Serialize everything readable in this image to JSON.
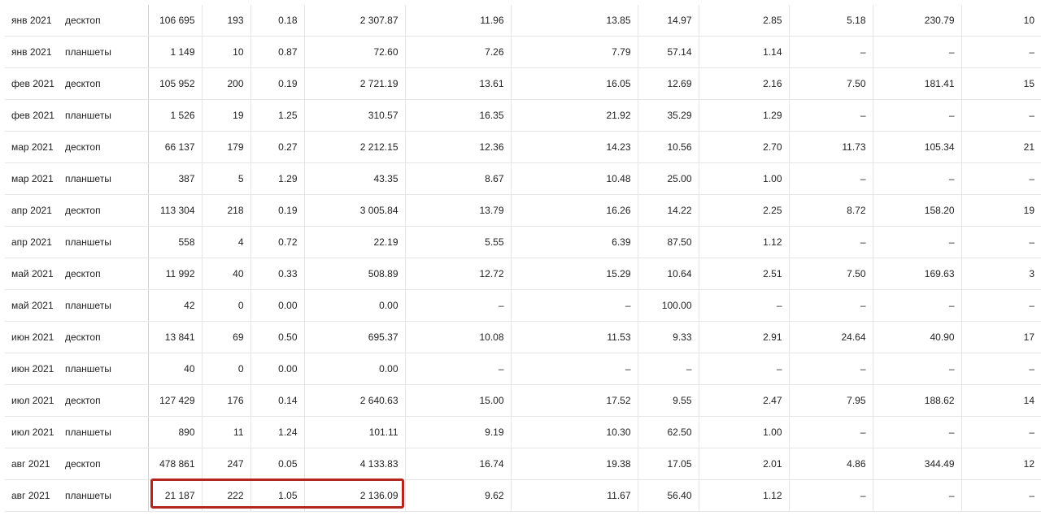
{
  "rows": [
    {
      "month": "янв 2021",
      "device": "десктоп",
      "values": [
        "106 695",
        "193",
        "0.18",
        "2 307.87",
        "11.96",
        "13.85",
        "14.97",
        "2.85",
        "5.18",
        "230.79",
        "10"
      ]
    },
    {
      "month": "янв 2021",
      "device": "планшеты",
      "values": [
        "1 149",
        "10",
        "0.87",
        "72.60",
        "7.26",
        "7.79",
        "57.14",
        "1.14",
        "–",
        "–",
        "–"
      ]
    },
    {
      "month": "фев 2021",
      "device": "десктоп",
      "values": [
        "105 952",
        "200",
        "0.19",
        "2 721.19",
        "13.61",
        "16.05",
        "12.69",
        "2.16",
        "7.50",
        "181.41",
        "15"
      ]
    },
    {
      "month": "фев 2021",
      "device": "планшеты",
      "values": [
        "1 526",
        "19",
        "1.25",
        "310.57",
        "16.35",
        "21.92",
        "35.29",
        "1.29",
        "–",
        "–",
        "–"
      ]
    },
    {
      "month": "мар 2021",
      "device": "десктоп",
      "values": [
        "66 137",
        "179",
        "0.27",
        "2 212.15",
        "12.36",
        "14.23",
        "10.56",
        "2.70",
        "11.73",
        "105.34",
        "21"
      ]
    },
    {
      "month": "мар 2021",
      "device": "планшеты",
      "values": [
        "387",
        "5",
        "1.29",
        "43.35",
        "8.67",
        "10.48",
        "25.00",
        "1.00",
        "–",
        "–",
        "–"
      ]
    },
    {
      "month": "апр 2021",
      "device": "десктоп",
      "values": [
        "113 304",
        "218",
        "0.19",
        "3 005.84",
        "13.79",
        "16.26",
        "14.22",
        "2.25",
        "8.72",
        "158.20",
        "19"
      ]
    },
    {
      "month": "апр 2021",
      "device": "планшеты",
      "values": [
        "558",
        "4",
        "0.72",
        "22.19",
        "5.55",
        "6.39",
        "87.50",
        "1.12",
        "–",
        "–",
        "–"
      ]
    },
    {
      "month": "май 2021",
      "device": "десктоп",
      "values": [
        "11 992",
        "40",
        "0.33",
        "508.89",
        "12.72",
        "15.29",
        "10.64",
        "2.51",
        "7.50",
        "169.63",
        "3"
      ]
    },
    {
      "month": "май 2021",
      "device": "планшеты",
      "values": [
        "42",
        "0",
        "0.00",
        "0.00",
        "–",
        "–",
        "100.00",
        "–",
        "–",
        "–",
        "–"
      ]
    },
    {
      "month": "июн 2021",
      "device": "десктоп",
      "values": [
        "13 841",
        "69",
        "0.50",
        "695.37",
        "10.08",
        "11.53",
        "9.33",
        "2.91",
        "24.64",
        "40.90",
        "17"
      ]
    },
    {
      "month": "июн 2021",
      "device": "планшеты",
      "values": [
        "40",
        "0",
        "0.00",
        "0.00",
        "–",
        "–",
        "–",
        "–",
        "–",
        "–",
        "–"
      ]
    },
    {
      "month": "июл 2021",
      "device": "десктоп",
      "values": [
        "127 429",
        "176",
        "0.14",
        "2 640.63",
        "15.00",
        "17.52",
        "9.55",
        "2.47",
        "7.95",
        "188.62",
        "14"
      ]
    },
    {
      "month": "июл 2021",
      "device": "планшеты",
      "values": [
        "890",
        "11",
        "1.24",
        "101.11",
        "9.19",
        "10.30",
        "62.50",
        "1.00",
        "–",
        "–",
        "–"
      ]
    },
    {
      "month": "авг 2021",
      "device": "десктоп",
      "values": [
        "478 861",
        "247",
        "0.05",
        "4 133.83",
        "16.74",
        "19.38",
        "17.05",
        "2.01",
        "4.86",
        "344.49",
        "12"
      ]
    },
    {
      "month": "авг 2021",
      "device": "планшеты",
      "values": [
        "21 187",
        "222",
        "1.05",
        "2 136.09",
        "9.62",
        "11.67",
        "56.40",
        "1.12",
        "–",
        "–",
        "–"
      ]
    }
  ],
  "highlight": {
    "row": 15,
    "color": "#b3261e"
  }
}
